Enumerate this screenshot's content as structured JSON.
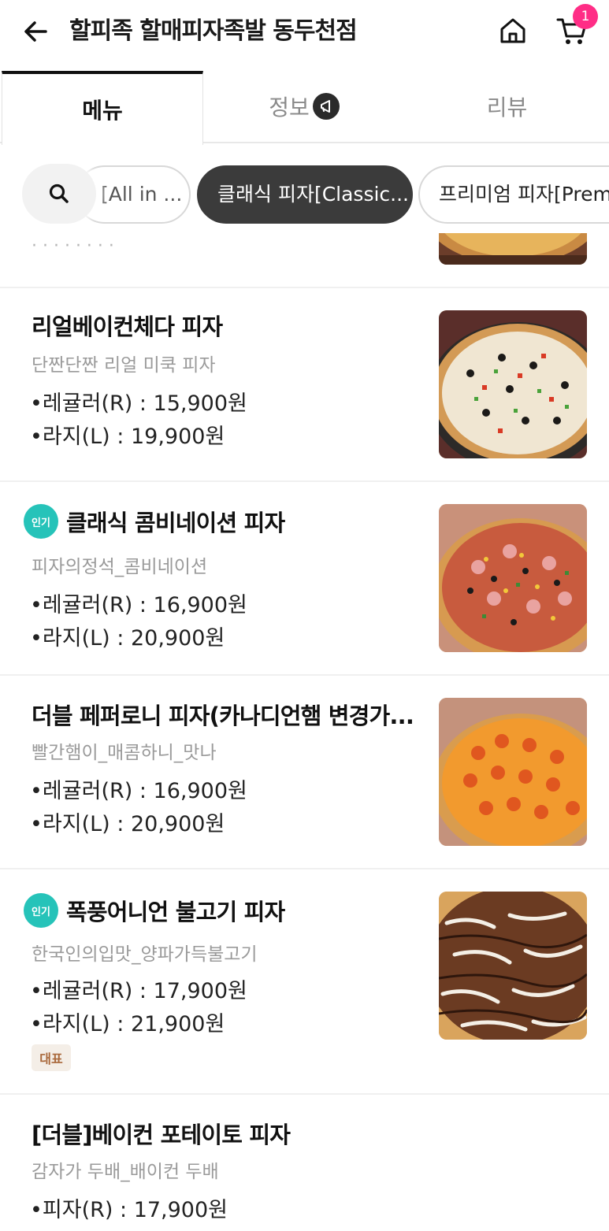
{
  "header": {
    "store_name": "할피족 할매피자족발 동두천점",
    "cart_count": "1"
  },
  "tabs": [
    {
      "label": "메뉴"
    },
    {
      "label": "정보"
    },
    {
      "label": "리뷰"
    }
  ],
  "categories": [
    {
      "label": "[All in ..."
    },
    {
      "label": "클래식 피자[Classic..."
    },
    {
      "label": "프리미엄 피자[Premi"
    }
  ],
  "partial_item": {
    "text": "· · · · ·  ·  ·  ·"
  },
  "menu_items": [
    {
      "name": "리얼베이컨체다 피자",
      "description": "단짠단짠 리얼 미쿡 피자",
      "prices": [
        "•레귤러(R) : 15,900원",
        "•라지(L) : 19,900원"
      ]
    },
    {
      "badge": "인기",
      "name": "클래식 콤비네이션 피자",
      "description": "피자의정석_콤비네이션",
      "prices": [
        "•레귤러(R) : 16,900원",
        "•라지(L) : 20,900원"
      ]
    },
    {
      "name": "더블 페퍼로니 피자(카나디언햄 변경가...",
      "description": "빨간햄이_매콤하니_맛나",
      "prices": [
        "•레귤러(R) : 16,900원",
        "•라지(L) : 20,900원"
      ]
    },
    {
      "badge": "인기",
      "name": "폭풍어니언 불고기 피자",
      "description": "한국인의입맛_양파가득불고기",
      "prices": [
        "•레귤러(R) : 17,900원",
        "•라지(L) : 21,900원"
      ],
      "tag": "대표"
    },
    {
      "name": "[더블]베이컨 포테이토 피자",
      "description": "감자가 두배_배이컨 두배",
      "prices": [
        "•피자(R) : 17,900원"
      ]
    }
  ],
  "colors": {
    "accent_badge": "#ff2d86",
    "popular_badge": "#26c3b9",
    "active_chip": "#3b3b3b",
    "rep_tag_bg": "#f4eee7",
    "rep_tag_text": "#a9683b"
  }
}
